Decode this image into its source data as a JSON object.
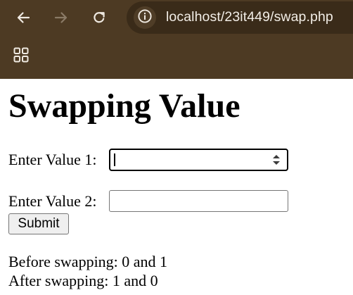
{
  "browser": {
    "url": "localhost/23it449/swap.php",
    "icons": {
      "back": "arrow-left-icon",
      "forward": "arrow-right-icon",
      "reload": "reload-icon",
      "site_info": "info-icon",
      "apps": "apps-grid-icon"
    },
    "colors": {
      "chrome_background": "#4d3a23",
      "omnibox_background": "#3a2b19"
    }
  },
  "page": {
    "title": "Swapping Value",
    "form": {
      "value1_label": "Enter Value 1:",
      "value1_value": "",
      "value2_label": "Enter Value 2:",
      "value2_value": "",
      "submit_label": "Submit"
    },
    "results": {
      "before": "Before swapping: 0 and 1",
      "after": "After swapping: 1 and 0"
    }
  }
}
